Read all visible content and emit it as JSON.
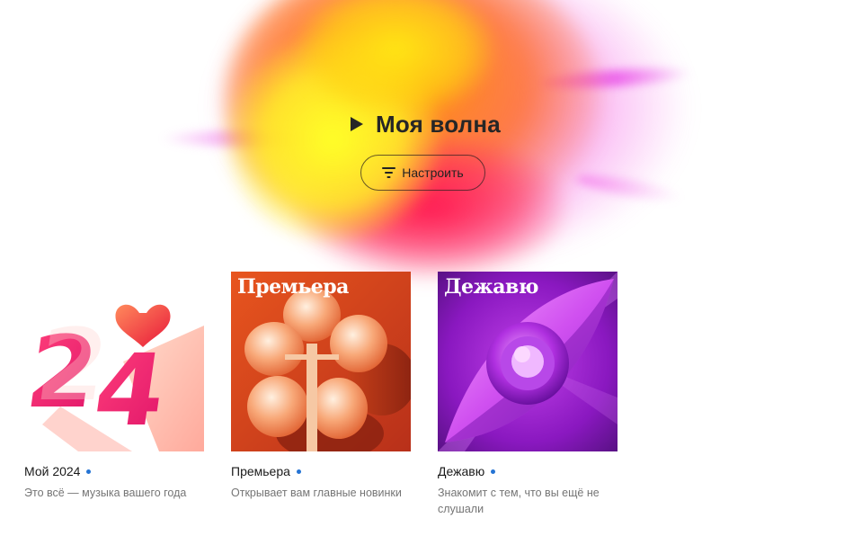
{
  "wave": {
    "title": "Моя волна",
    "tune_label": "Настроить"
  },
  "cards": [
    {
      "title": "Мой 2024",
      "subtitle": "Это всё — музыка вашего года",
      "cover_text": "24"
    },
    {
      "title": "Премьера",
      "subtitle": "Открывает вам главные новинки",
      "cover_text": "Премьера"
    },
    {
      "title": "Дежавю",
      "subtitle": "Знакомит с тем, что вы ещё не слушали",
      "cover_text": "Дежавю"
    }
  ],
  "colors": {
    "dot": "#2574d4",
    "text_primary": "#1a1a1a",
    "text_secondary": "#757575"
  },
  "icons": [
    "play-icon",
    "filter-icon",
    "heart-icon"
  ]
}
